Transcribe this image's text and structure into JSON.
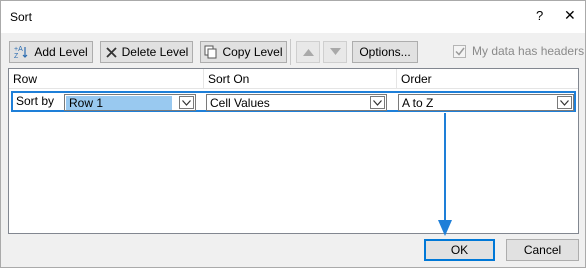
{
  "window": {
    "title": "Sort",
    "help_glyph": "?",
    "close_glyph": "✕"
  },
  "toolbar": {
    "add_level": "Add Level",
    "delete_level": "Delete Level",
    "copy_level": "Copy Level",
    "options": "Options...",
    "headers_checkbox": "My data has headers",
    "headers_checked": true
  },
  "grid": {
    "columns": [
      "Row",
      "Sort On",
      "Order"
    ],
    "rows": [
      {
        "label": "Sort by",
        "row": "Row 1",
        "sort_on": "Cell Values",
        "order": "A to Z"
      }
    ]
  },
  "footer": {
    "ok": "OK",
    "cancel": "Cancel"
  },
  "colors": {
    "accent": "#0078d7",
    "selection": "#99c9f0",
    "annotation_arrow": "#1e7fd8"
  }
}
